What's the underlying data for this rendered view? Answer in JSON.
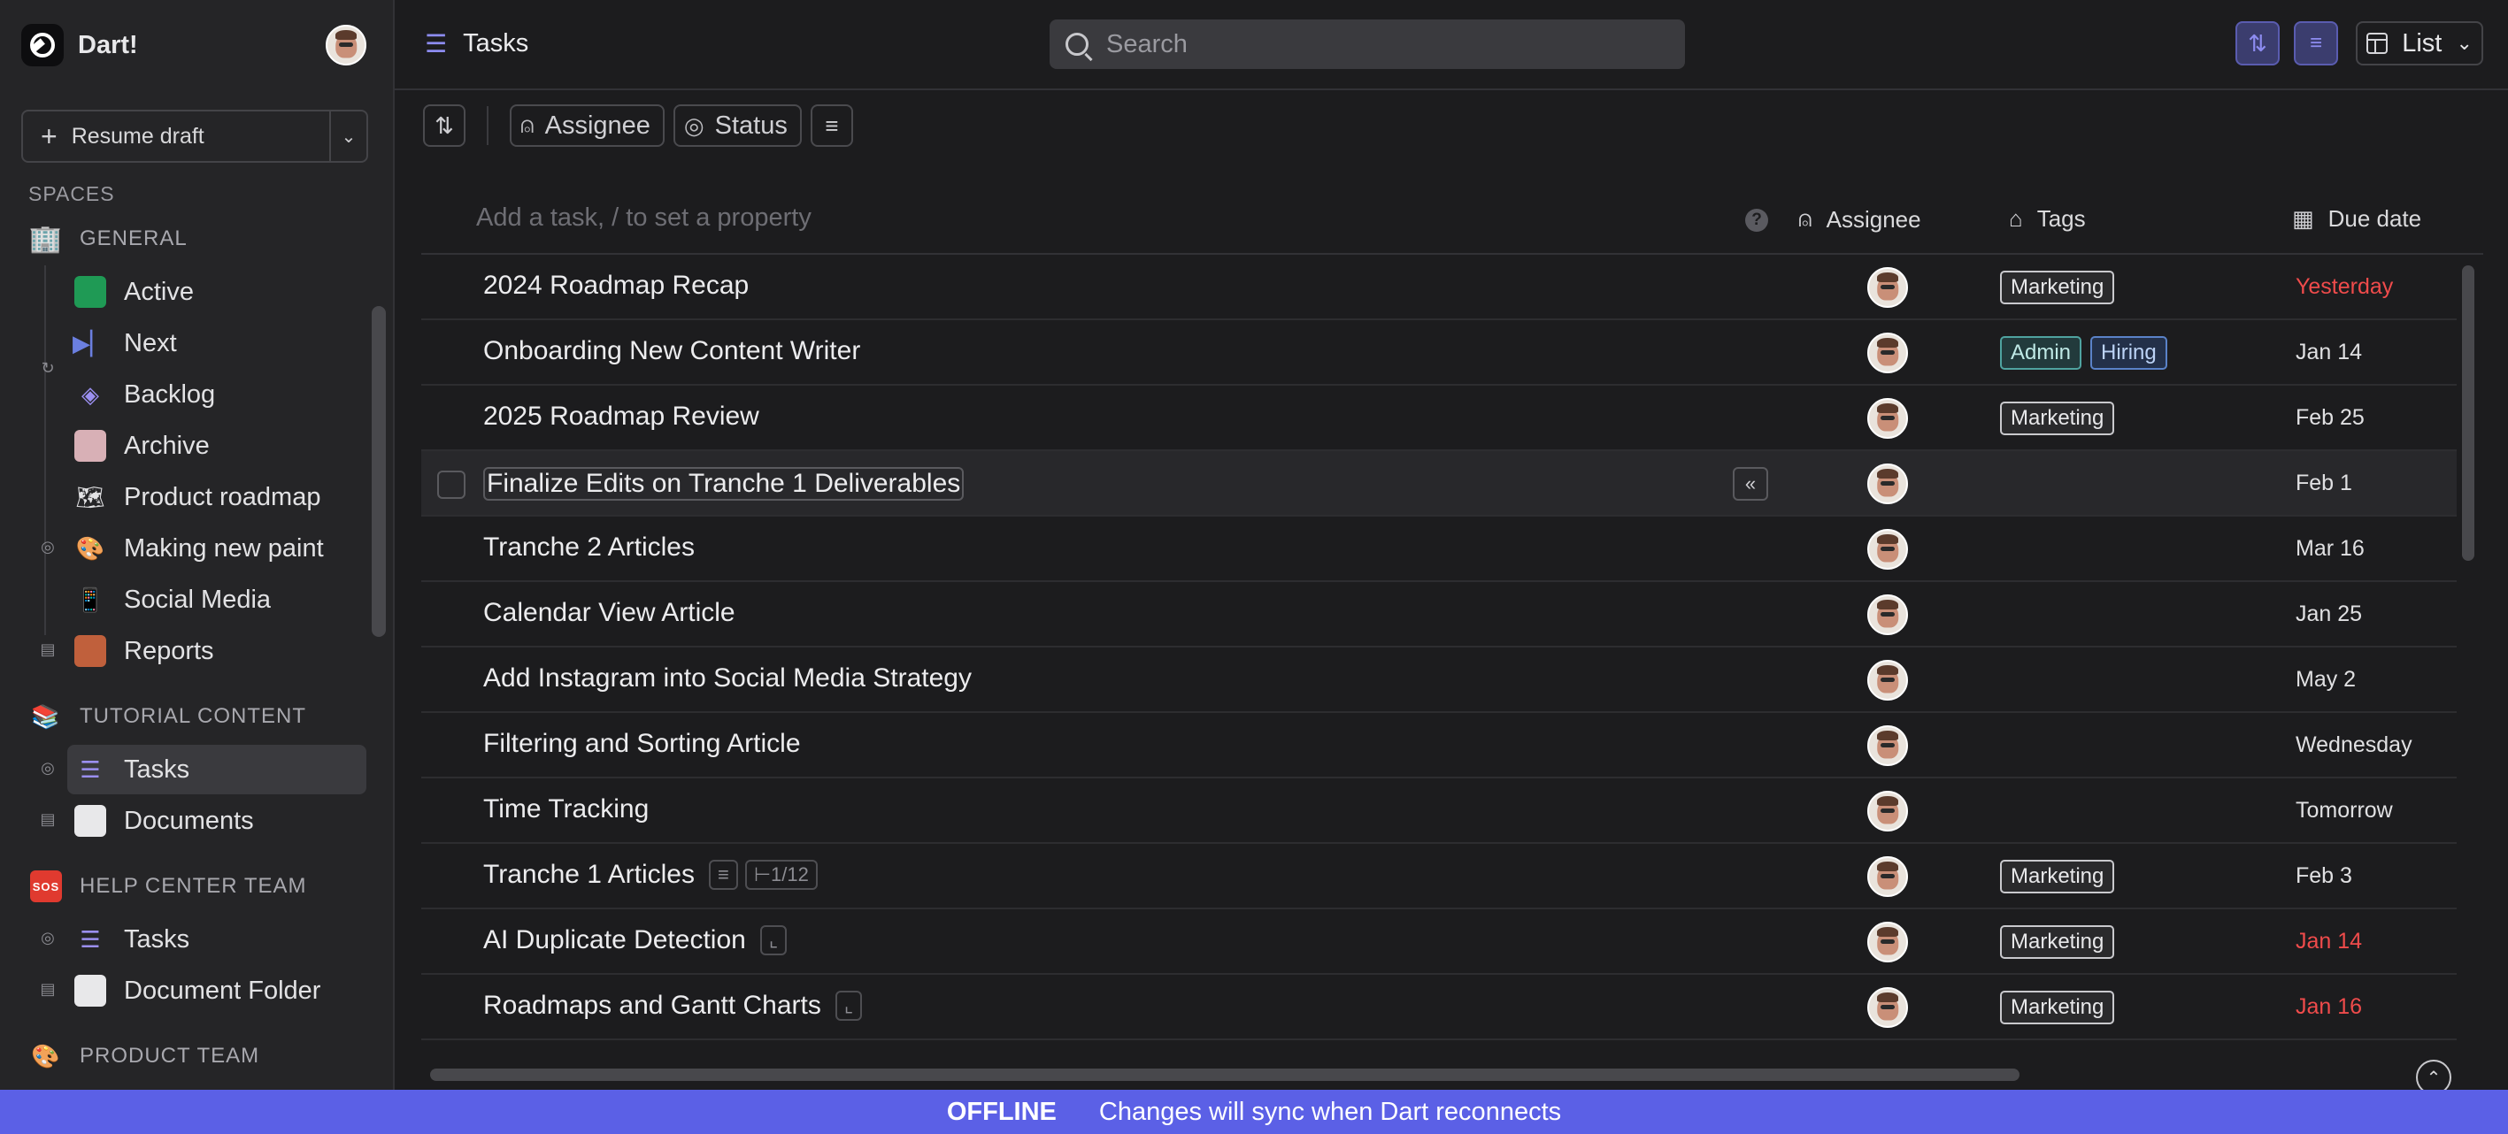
{
  "app": {
    "name": "Dart!"
  },
  "sidebar": {
    "resume_label": "Resume draft",
    "spaces_label": "SPACES",
    "general_label": "GENERAL",
    "general_items": [
      {
        "label": "Active",
        "icon": "green-box-icon"
      },
      {
        "label": "Next",
        "icon": "play-next-icon"
      },
      {
        "label": "Backlog",
        "icon": "layers-icon"
      },
      {
        "label": "Archive",
        "icon": "archive-box-icon"
      },
      {
        "label": "Product roadmap",
        "icon": "map-emoji-icon"
      },
      {
        "label": "Making new paint",
        "icon": "palette-emoji-icon"
      },
      {
        "label": "Social Media",
        "icon": "phone-emoji-icon"
      },
      {
        "label": "Reports",
        "icon": "report-doc-icon"
      }
    ],
    "tutorial_label": "TUTORIAL CONTENT",
    "tutorial_items": [
      {
        "label": "Tasks",
        "icon": "tasks-list-icon"
      },
      {
        "label": "Documents",
        "icon": "document-icon"
      }
    ],
    "help_label": "HELP CENTER TEAM",
    "help_items": [
      {
        "label": "Tasks",
        "icon": "tasks-list-icon"
      },
      {
        "label": "Document Folder",
        "icon": "document-icon"
      }
    ],
    "product_label": "PRODUCT TEAM"
  },
  "topbar": {
    "title": "Tasks",
    "search_placeholder": "Search",
    "view_label": "List"
  },
  "filters": {
    "assignee_label": "Assignee",
    "status_label": "Status"
  },
  "table": {
    "add_placeholder": "Add a task, / to set a property",
    "col_assignee": "Assignee",
    "col_tags": "Tags",
    "col_due": "Due date",
    "rows": [
      {
        "title": "2024 Roadmap Recap",
        "tags": [
          "Marketing"
        ],
        "due": "Yesterday",
        "overdue": true
      },
      {
        "title": "Onboarding New Content Writer",
        "tags": [
          "Admin",
          "Hiring"
        ],
        "due": "Jan 14",
        "overdue": false
      },
      {
        "title": "2025 Roadmap Review",
        "tags": [
          "Marketing"
        ],
        "due": "Feb 25",
        "overdue": false
      },
      {
        "title": "Finalize Edits on Tranche 1 Deliverables",
        "tags": [],
        "due": "Feb 1",
        "overdue": false
      },
      {
        "title": "Tranche 2 Articles",
        "tags": [],
        "due": "Mar 16",
        "overdue": false
      },
      {
        "title": "Calendar View Article",
        "tags": [],
        "due": "Jan 25",
        "overdue": false
      },
      {
        "title": "Add Instagram into Social Media Strategy",
        "tags": [],
        "due": "May 2",
        "overdue": false
      },
      {
        "title": "Filtering and Sorting Article",
        "tags": [],
        "due": "Wednesday",
        "overdue": false
      },
      {
        "title": "Time Tracking",
        "tags": [],
        "due": "Tomorrow",
        "overdue": false
      },
      {
        "title": "Tranche 1 Articles",
        "tags": [
          "Marketing"
        ],
        "due": "Feb 3",
        "overdue": false,
        "subtasks": "1/12"
      },
      {
        "title": "AI Duplicate Detection",
        "tags": [
          "Marketing"
        ],
        "due": "Jan 14",
        "overdue": true
      },
      {
        "title": "Roadmaps and Gantt Charts",
        "tags": [
          "Marketing"
        ],
        "due": "Jan 16",
        "overdue": true
      }
    ]
  },
  "offline": {
    "label": "OFFLINE",
    "message": "Changes will sync when Dart reconnects"
  },
  "colors": {
    "accent": "#5b60e6",
    "overdue": "#ef4b4b",
    "background": "#1c1c1e",
    "sidebar": "#252527"
  }
}
